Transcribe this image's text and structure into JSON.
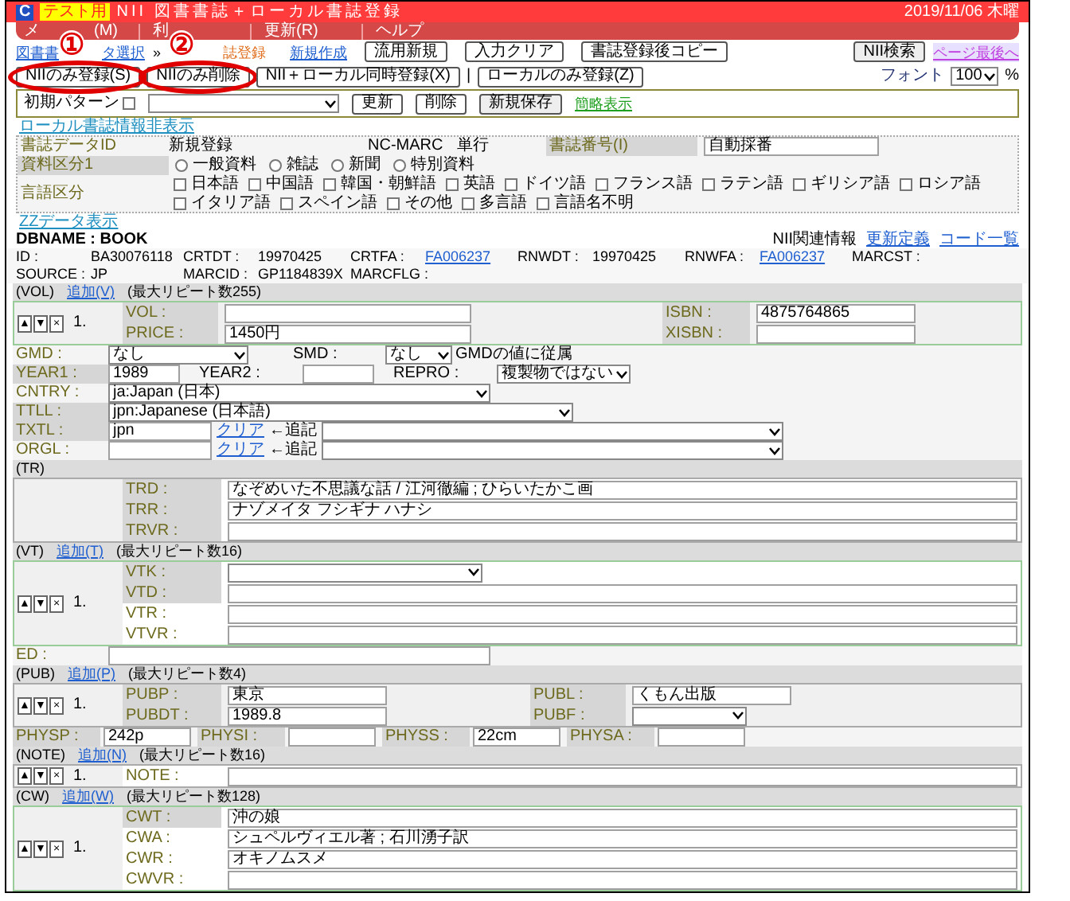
{
  "window": {
    "logo": "C",
    "badge": "テスト用",
    "title": "NII 図書書誌＋ローカル書誌登録",
    "date": "2019/11/06 木曜"
  },
  "menu": [
    "メ",
    "(M)",
    "利",
    "更新(R)",
    "ヘルプ"
  ],
  "breadcrumb": [
    {
      "label": "図書書",
      "kind": "link"
    },
    {
      "label": "タ選択",
      "kind": "link"
    },
    {
      "label": "»",
      "kind": "sep"
    },
    {
      "label": "誌登録",
      "kind": "current"
    }
  ],
  "toolbar": {
    "link": "新規作成",
    "buttons": [
      "流用新規",
      "入力クリア",
      "書誌登録後コピー"
    ],
    "search_button": "NII検索",
    "page_end_link": "ページ最後へ"
  },
  "actions": {
    "buttons": [
      "NIIのみ登録(S)",
      "NIIのみ削除",
      "NII＋ローカル同時登録(X)"
    ],
    "separator": "|",
    "local_button": "ローカルのみ登録(Z)",
    "font_label": "フォント",
    "font_size": "100",
    "percent": "%"
  },
  "annotations": [
    "①",
    "②"
  ],
  "pattern": {
    "label": "初期パターン",
    "checked": false,
    "buttons": [
      "更新",
      "削除",
      "新規保存"
    ],
    "link": "簡略表示"
  },
  "local_toggle": "ローカル書誌情報非表示",
  "local": {
    "id_label": "書誌データID",
    "id_value": "新規登録",
    "marc_label": "NC-MARC",
    "marc_value": "単行",
    "number_label": "書誌番号(I)",
    "number_value": "自動採番",
    "type_label": "資料区分1",
    "types": [
      {
        "label": "一般資料",
        "selected": false
      },
      {
        "label": "雑誌",
        "selected": false
      },
      {
        "label": "新聞",
        "selected": false
      },
      {
        "label": "特別資料",
        "selected": false
      }
    ],
    "lang_label": "言語区分",
    "languages": [
      {
        "label": "日本語",
        "checked": false
      },
      {
        "label": "中国語",
        "checked": false
      },
      {
        "label": "韓国・朝鮮語",
        "checked": false
      },
      {
        "label": "英語",
        "checked": false
      },
      {
        "label": "ドイツ語",
        "checked": false
      },
      {
        "label": "フランス語",
        "checked": false
      },
      {
        "label": "ラテン語",
        "checked": false
      },
      {
        "label": "ギリシア語",
        "checked": false
      },
      {
        "label": "ロシア語",
        "checked": false
      },
      {
        "label": "イタリア語",
        "checked": false
      },
      {
        "label": "スペイン語",
        "checked": false
      },
      {
        "label": "その他",
        "checked": false
      },
      {
        "label": "多言語",
        "checked": false
      },
      {
        "label": "言語名不明",
        "checked": false
      }
    ]
  },
  "zz_link": "ZZデータ表示",
  "dbname": "DBNAME : BOOK",
  "nii_links": [
    {
      "label": "NII関連情報",
      "kind": "text"
    },
    {
      "label": "更新定義",
      "kind": "link"
    },
    {
      "label": "コード一覧",
      "kind": "link"
    }
  ],
  "meta": [
    [
      {
        "label": "ID :",
        "value": "BA30076118",
        "kind": "text"
      },
      {
        "label": "CRTDT :",
        "value": "19970425",
        "kind": "text"
      },
      {
        "label": "CRTFA :",
        "value": "FA006237",
        "kind": "link"
      },
      {
        "label": "RNWDT :",
        "value": "19970425",
        "kind": "text"
      },
      {
        "label": "RNWFA :",
        "value": "FA006237",
        "kind": "link"
      },
      {
        "label": "MARCST :"
      }
    ],
    [
      {
        "label": "SOURCE :",
        "value": "JP",
        "kind": "text"
      },
      {
        "label": "MARCID :",
        "value": "GP1184839X",
        "kind": "text"
      },
      {
        "label": "MARCFLG :"
      }
    ]
  ],
  "vol": {
    "tag": "(VOL)",
    "add_link": "追加(V)",
    "max": "(最大リピート数255)",
    "controls": [
      "▲",
      "▼",
      "×"
    ],
    "index": "1.",
    "fields": [
      {
        "label": "VOL :"
      },
      {
        "label": "ISBN :",
        "value": "4875764865"
      },
      {
        "label": "PRICE :",
        "value": "1450円"
      },
      {
        "label": "XISBN :"
      }
    ]
  },
  "fixed": {
    "gmd": {
      "label": "GMD :",
      "value": "なし"
    },
    "smd": {
      "label": "SMD :",
      "value": "なし",
      "note": "GMDの値に従属"
    },
    "year1": {
      "label": "YEAR1 :",
      "value": "1989"
    },
    "year2": {
      "label": "YEAR2 :"
    },
    "repro": {
      "label": "REPRO :",
      "value": "複製物ではない"
    },
    "cntry": {
      "label": "CNTRY :",
      "value": "ja:Japan (日本)"
    },
    "ttll": {
      "label": "TTLL :",
      "value": "jpn:Japanese (日本語)"
    },
    "txtl": {
      "label": "TXTL :",
      "value": "jpn",
      "clear": "クリア",
      "append": "←追記"
    },
    "orgl": {
      "label": "ORGL :",
      "clear": "クリア",
      "append": "←追記"
    }
  },
  "tr": {
    "tag": "(TR)",
    "fields": [
      {
        "label": "TRD :",
        "value": "なぞめいた不思議な話 / 江河徹編 ; ひらいたかこ画"
      },
      {
        "label": "TRR :",
        "value": "ナゾメイタ フシギナ ハナシ"
      },
      {
        "label": "TRVR :"
      }
    ]
  },
  "vt": {
    "tag": "(VT)",
    "add_link": "追加(T)",
    "max": "(最大リピート数16)",
    "controls": [
      "▲",
      "▼",
      "×"
    ],
    "index": "1.",
    "fields": [
      {
        "label": "VTK :",
        "kind": "select"
      },
      {
        "label": "VTD :",
        "kind": "input"
      },
      {
        "label": "VTR :",
        "kind": "input"
      },
      {
        "label": "VTVR :",
        "kind": "input"
      }
    ]
  },
  "ed": {
    "label": "ED :"
  },
  "pub": {
    "tag": "(PUB)",
    "add_link": "追加(P)",
    "max": "(最大リピート数4)",
    "controls": [
      "▲",
      "▼",
      "×"
    ],
    "index": "1.",
    "fields": [
      {
        "label": "PUBP :",
        "value": "東京",
        "kind": "input"
      },
      {
        "label": "PUBL :",
        "value": "くもん出版",
        "kind": "input"
      },
      {
        "label": "PUBDT :",
        "value": "1989.8",
        "kind": "input"
      },
      {
        "label": "PUBF :",
        "kind": "select"
      }
    ]
  },
  "phys": [
    {
      "label": "PHYSP :",
      "value": "242p"
    },
    {
      "label": "PHYSI :"
    },
    {
      "label": "PHYSS :",
      "value": "22cm"
    },
    {
      "label": "PHYSA :"
    }
  ],
  "note": {
    "tag": "(NOTE)",
    "add_link": "追加(N)",
    "max": "(最大リピート数16)",
    "controls": [
      "▲",
      "▼",
      "×"
    ],
    "index": "1.",
    "fields": [
      {
        "label": "NOTE :"
      }
    ]
  },
  "cw": {
    "tag": "(CW)",
    "add_link": "追加(W)",
    "max": "(最大リピート数128)",
    "controls": [
      "▲",
      "▼",
      "×"
    ],
    "index": "1.",
    "fields": [
      {
        "label": "CWT :",
        "value": "沖の娘"
      },
      {
        "label": "CWA :",
        "value": "シュペルヴィエル著 ; 石川湧子訳"
      },
      {
        "label": "CWR :",
        "value": "オキノムスメ"
      },
      {
        "label": "CWVR :"
      }
    ]
  }
}
